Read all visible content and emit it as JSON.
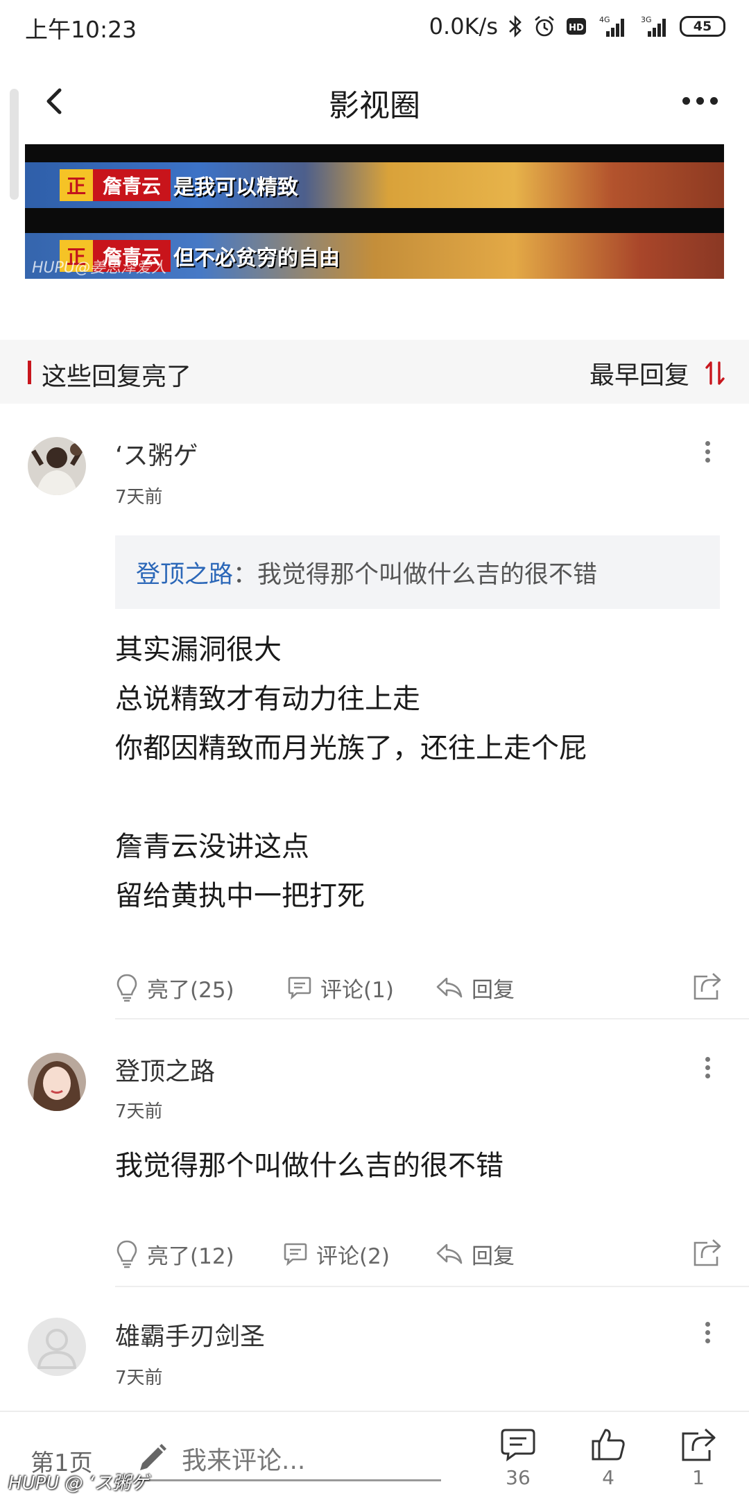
{
  "status_bar": {
    "time": "上午10:23",
    "net_speed": "0.0K/s",
    "icons": [
      "bluetooth-icon",
      "alarm-icon",
      "hd-icon",
      "signal-4g-icon",
      "signal-3g-icon"
    ],
    "battery": "45"
  },
  "nav": {
    "title": "影视圈"
  },
  "post_image": {
    "caption_tag": "正",
    "speaker": "詹青云",
    "line1": "是我可以精致",
    "line2": "但不必贫穷的自由",
    "watermark": "HUPU@姜思泽爱人"
  },
  "section": {
    "title": "这些回复亮了",
    "sort_label": "最早回复",
    "accent_color": "#c8161d"
  },
  "comments": [
    {
      "username": "‘ス粥ゲ",
      "time": "7天前",
      "quote": {
        "author": "登顶之路",
        "separator": "：",
        "text": "我觉得那个叫做什么吉的很不错"
      },
      "body_lines": [
        "其实漏洞很大",
        "总说精致才有动力往上走",
        "你都因精致而月光族了，还往上走个屁",
        "",
        "詹青云没讲这点",
        "留给黄执中一把打死"
      ],
      "likes": "亮了(25)",
      "comments": "评论(1)",
      "reply": "回复"
    },
    {
      "username": "登顶之路",
      "time": "7天前",
      "body_lines": [
        "我觉得那个叫做什么吉的很不错"
      ],
      "likes": "亮了(12)",
      "comments": "评论(2)",
      "reply": "回复"
    },
    {
      "username": "雄霸手刃剑圣",
      "time": "7天前"
    }
  ],
  "bottom_bar": {
    "page": "第1页",
    "input_placeholder": "我来评论...",
    "comment_count": "36",
    "like_count": "4",
    "share_count": "1"
  },
  "screen_watermark": "HUPU @ ‘ス粥ゲ"
}
